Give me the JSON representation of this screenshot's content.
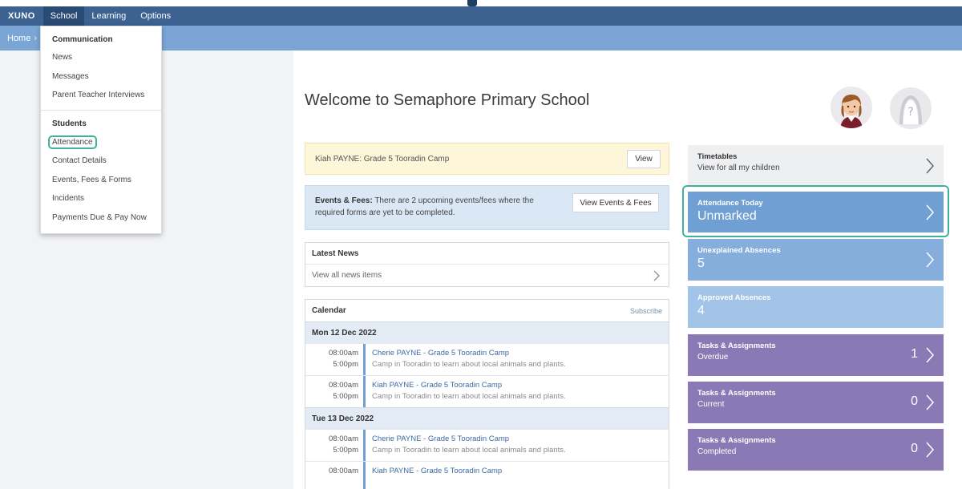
{
  "nav": {
    "brand": "XUNO",
    "items": [
      "School",
      "Learning",
      "Options"
    ]
  },
  "breadcrumb": {
    "home": "Home"
  },
  "dropdown": {
    "sections": [
      {
        "heading": "Communication",
        "items": [
          "News",
          "Messages",
          "Parent Teacher Interviews"
        ]
      },
      {
        "heading": "Students",
        "items": [
          "Attendance",
          "Contact Details",
          "Events, Fees & Forms",
          "Incidents",
          "Payments Due & Pay Now"
        ]
      }
    ]
  },
  "welcome": {
    "title": "Welcome to Semaphore Primary School"
  },
  "notice_yellow": {
    "text": "Kiah PAYNE: Grade 5 Tooradin Camp",
    "button": "View"
  },
  "notice_blue": {
    "bold": "Events & Fees:",
    "text": "There are 2 upcoming events/fees where the required forms are yet to be completed.",
    "button": "View Events & Fees"
  },
  "news": {
    "title": "Latest News",
    "link": "View all news items"
  },
  "calendar": {
    "title": "Calendar",
    "subscribe": "Subscribe",
    "days": [
      {
        "date": "Mon 12 Dec 2022",
        "events": [
          {
            "start": "08:00am",
            "end": "5:00pm",
            "title": "Cherie PAYNE - Grade 5 Tooradin Camp",
            "desc": "Camp in Tooradin to learn about local animals and plants."
          },
          {
            "start": "08:00am",
            "end": "5:00pm",
            "title": "Kiah PAYNE - Grade 5 Tooradin Camp",
            "desc": "Camp in Tooradin to learn about local animals and plants."
          }
        ]
      },
      {
        "date": "Tue 13 Dec 2022",
        "events": [
          {
            "start": "08:00am",
            "end": "5:00pm",
            "title": "Cherie PAYNE - Grade 5 Tooradin Camp",
            "desc": "Camp in Tooradin to learn about local animals and plants."
          },
          {
            "start": "08:00am",
            "end": "",
            "title": "Kiah PAYNE - Grade 5 Tooradin Camp",
            "desc": ""
          }
        ]
      }
    ]
  },
  "tiles": {
    "timetables": {
      "title": "Timetables",
      "sub": "View for all my children"
    },
    "attendance": {
      "title": "Attendance Today",
      "value": "Unmarked"
    },
    "unexplained": {
      "title": "Unexplained Absences",
      "value": "5"
    },
    "approved": {
      "title": "Approved Absences",
      "value": "4"
    },
    "tasks_overdue": {
      "title": "Tasks & Assignments",
      "sub": "Overdue",
      "count": "1"
    },
    "tasks_current": {
      "title": "Tasks & Assignments",
      "sub": "Current",
      "count": "0"
    },
    "tasks_completed": {
      "title": "Tasks & Assignments",
      "sub": "Completed",
      "count": "0"
    }
  },
  "colors": {
    "nav": "#3c6291",
    "breadcrumb_bar": "#7aa5d5",
    "highlight": "#3fb39a",
    "tile_blue": "#6f9fd3",
    "tile_purple": "#8a79b4"
  }
}
